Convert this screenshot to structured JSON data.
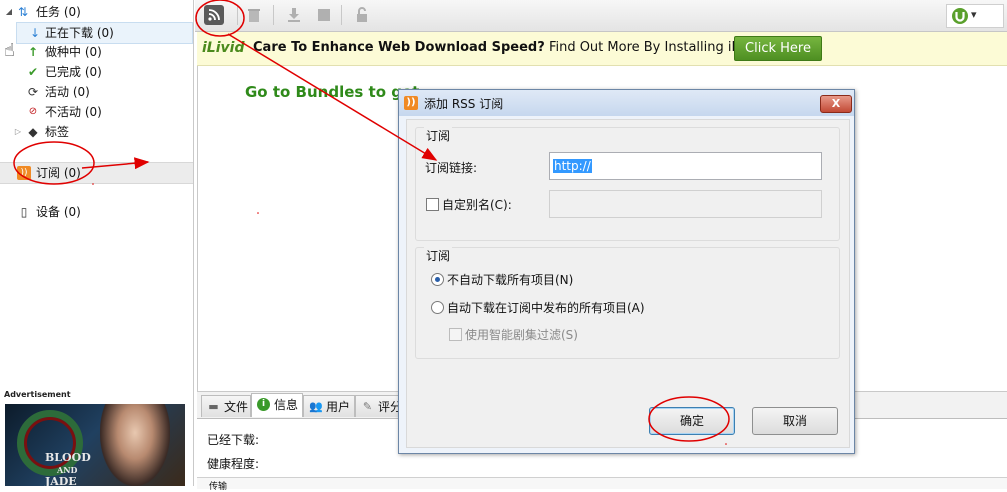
{
  "sidebar": {
    "items": [
      {
        "label": "任务 (0)",
        "icon": "torrent-arrows-icon"
      },
      {
        "label": "正在下载 (0)",
        "icon": "download-arrow-icon"
      },
      {
        "label": "做种中 (0)",
        "icon": "seeding-arrow-icon"
      },
      {
        "label": "已完成 (0)",
        "icon": "checkmark-icon"
      },
      {
        "label": "活动 (0)",
        "icon": "refresh-icon"
      },
      {
        "label": "不活动 (0)",
        "icon": "inactive-icon"
      },
      {
        "label": "标签",
        "icon": "tag-icon"
      },
      {
        "label": "订阅 (0)",
        "icon": "rss-icon"
      },
      {
        "label": "设备 (0)",
        "icon": "device-icon"
      }
    ]
  },
  "ad": {
    "title": "Advertisement",
    "text_line1": "BLOOD",
    "text_line2": "AND",
    "text_line3": "JADE"
  },
  "toolbar": {
    "buttons": [
      "rss-icon",
      "trash-icon",
      "download-icon",
      "stop-icon",
      "unlock-icon"
    ],
    "utorrent_icon": "utorrent-logo-icon",
    "caret": "▾"
  },
  "banner": {
    "logo": "iLivid",
    "headline": "Care To Enhance Web Download Speed?",
    "subtext": "Find Out More By Installing iLivid",
    "button": "Click Here"
  },
  "main": {
    "message": "Go to Bundles to get..."
  },
  "bottom": {
    "tabs": [
      {
        "label": "文件",
        "icon": "folder-icon"
      },
      {
        "label": "信息",
        "icon": "info-icon"
      },
      {
        "label": "用户",
        "icon": "users-icon"
      },
      {
        "label": "评分",
        "icon": "rating-icon"
      }
    ],
    "downloaded_label": "已经下载:",
    "health_label": "健康程度:",
    "row_label": "传输"
  },
  "dialog": {
    "title": "添加 RSS 订阅",
    "close": "X",
    "group1_title": "订阅",
    "url_label": "订阅链接:",
    "url_value": "http://",
    "alias_label": "自定别名(C):",
    "group2_title": "订阅",
    "radio1": "不自动下载所有项目(N)",
    "radio2": "自动下载在订阅中发布的所有项目(A)",
    "smart_filter": "使用智能剧集过滤(S)",
    "ok": "确定",
    "cancel": "取消"
  },
  "colors": {
    "annotation_red": "#e00000",
    "banner_green": "#4e8f22",
    "main_message_green": "#2f8a1a",
    "dialog_frame": "#6c86a6"
  }
}
